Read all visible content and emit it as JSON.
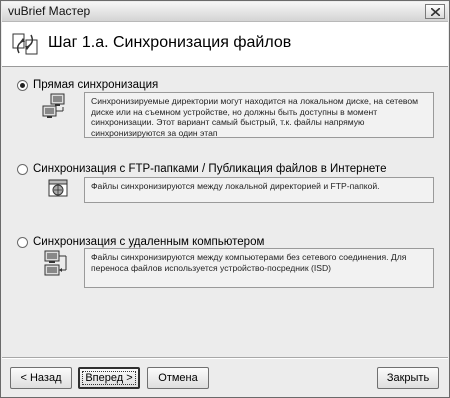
{
  "window": {
    "title": "vuBrief Мастер"
  },
  "header": {
    "step_title": "Шаг 1.а. Синхронизация файлов"
  },
  "options": [
    {
      "label": "Прямая синхронизация",
      "selected": true,
      "description": "Синхронизируемые директории могут находится на локальном диске, на сетевом диске или на съемном устройстве, но должны быть доступны в момент синхронизации. Этот вариант самый быстрый, т.к. файлы напрямую синхронизируются за один этап",
      "icon": "computers-sync-icon"
    },
    {
      "label": "Синхронизация с FTP-папками / Публикация файлов в Интернете",
      "selected": false,
      "description": "Файлы синхронизируются между локальной директорией и FTP-папкой.",
      "icon": "ftp-globe-icon"
    },
    {
      "label": "Синхронизация с удаленным компьютером",
      "selected": false,
      "description": "Файлы синхронизируются между компьютерами без сетевого соединения. Для переноса файлов используется устройство-посредник (ISD)",
      "icon": "remote-computer-icon"
    }
  ],
  "buttons": {
    "back": "< Назад",
    "next": "Вперед >",
    "cancel": "Отмена",
    "close": "Закрыть"
  }
}
